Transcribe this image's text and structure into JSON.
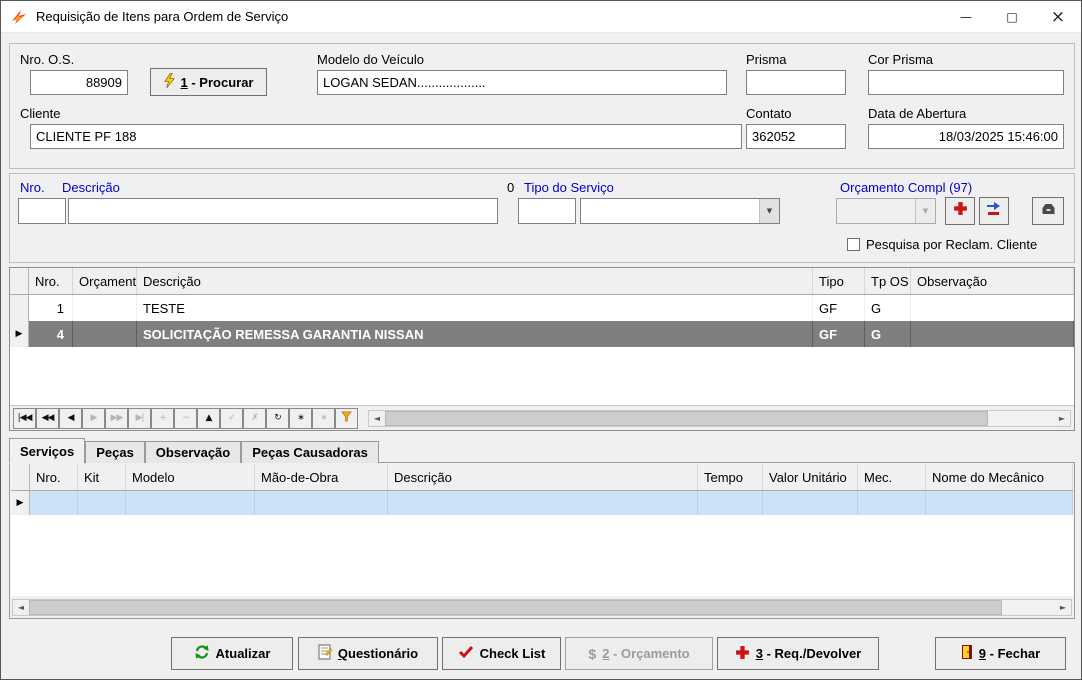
{
  "window": {
    "title": "Requisição de Itens para Ordem de Serviço"
  },
  "icons": {
    "row_indicator": "▶",
    "dropdown_arrow": "▼",
    "scroll_left": "◄",
    "scroll_right": "►",
    "minimize": "—",
    "maximize": "□",
    "close": "×",
    "dollar": "$"
  },
  "header": {
    "nro_os_label": "Nro. O.S.",
    "nro_os_value": "88909",
    "procurar_accel": "1",
    "procurar_rest": " - Procurar",
    "modelo_label": "Modelo do Veículo",
    "modelo_value": "LOGAN SEDAN...................",
    "prisma_label": "Prisma",
    "prisma_value": "",
    "cor_prisma_label": "Cor Prisma",
    "cor_prisma_value": "",
    "cliente_label": "Cliente",
    "cliente_value": "CLIENTE PF 188",
    "contato_label": "Contato",
    "contato_value": "362052",
    "data_abertura_label": "Data de Abertura",
    "data_abertura_value": "18/03/2025 15:46:00"
  },
  "filter": {
    "nro_label": "Nro.",
    "descricao_label": "Descrição",
    "zero": "0",
    "tipo_servico_label": "Tipo do Serviço",
    "orcamento_compl_label": "Orçamento Compl (97)",
    "pesquisa_checkbox_label": "Pesquisa por Reclam. Cliente",
    "nro_value": "",
    "descricao_value": "",
    "tipo_value": "",
    "tipo_servico_value": "",
    "orcamento_value": ""
  },
  "grid": {
    "columns": [
      "Nro.",
      "Orçamento",
      "Descrição",
      "Tipo",
      "Tp OS",
      "Observação"
    ],
    "rows": [
      [
        "1",
        "",
        "TESTE",
        "GF",
        "G",
        ""
      ],
      [
        "4",
        "",
        "SOLICITAÇÃO REMESSA GARANTIA NISSAN",
        "GF",
        "G",
        ""
      ]
    ]
  },
  "navigator": {
    "buttons": [
      {
        "name": "first",
        "glyph": "|◀◀"
      },
      {
        "name": "prior-page",
        "glyph": "◀◀"
      },
      {
        "name": "prior",
        "glyph": "◀"
      },
      {
        "name": "next",
        "glyph": "▶"
      },
      {
        "name": "next-page",
        "glyph": "▶▶"
      },
      {
        "name": "last",
        "glyph": "▶|"
      },
      {
        "name": "insert",
        "glyph": "+"
      },
      {
        "name": "delete",
        "glyph": "−"
      },
      {
        "name": "edit",
        "glyph": "▲"
      },
      {
        "name": "post",
        "glyph": "✓"
      },
      {
        "name": "cancel",
        "glyph": "✗"
      },
      {
        "name": "refresh",
        "glyph": "↻"
      },
      {
        "name": "bookmark",
        "glyph": "∗"
      },
      {
        "name": "goto-bookmark",
        "glyph": "∗"
      }
    ]
  },
  "tabs": [
    {
      "label": "Serviços"
    },
    {
      "label": "Peças"
    },
    {
      "label": "Observação"
    },
    {
      "label": "Peças Causadoras"
    }
  ],
  "services_grid": {
    "columns": [
      "Nro.",
      "Kit",
      "Modelo",
      "Mão-de-Obra",
      "Descrição",
      "Tempo",
      "Valor Unitário",
      "Mec.",
      "Nome do Mecânico"
    ]
  },
  "footer": {
    "atualizar_label": "Atualizar",
    "questionario_accel": "Q",
    "questionario_rest": "uestionário",
    "checklist_label": "Check List",
    "orcamento_accel": "2",
    "orcamento_rest": " - Orçamento",
    "req_accel": "3",
    "req_rest": " - Req./Devolver",
    "fechar_accel": "9",
    "fechar_rest": " - Fechar"
  }
}
